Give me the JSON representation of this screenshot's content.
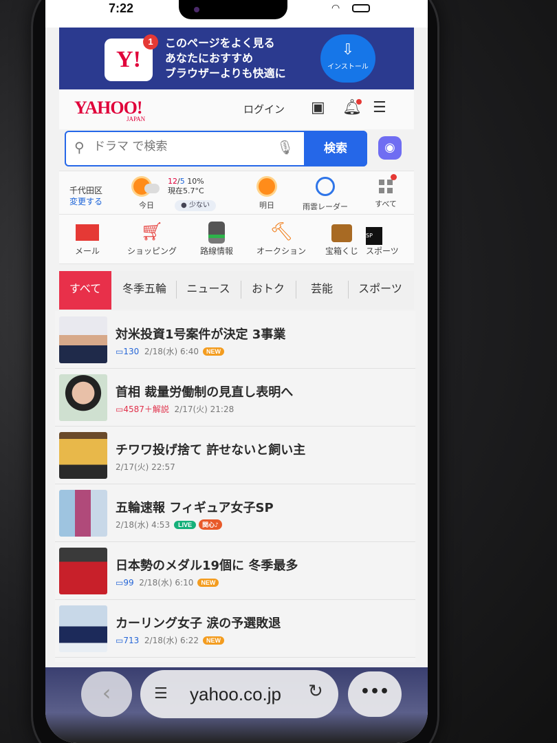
{
  "status": {
    "time": "7:22"
  },
  "banner": {
    "badge_count": "1",
    "logo_text": "Y!",
    "line1": "このページをよく見る",
    "line2": "あなたにおすすめ",
    "line3": "ブラウザーよりも快適に",
    "install_label": "インストール"
  },
  "header": {
    "logo": "YAHOO!",
    "logo_sub": "JAPAN",
    "login": "ログイン"
  },
  "search": {
    "placeholder": "ドラマ で検索",
    "button": "検索"
  },
  "weather": {
    "location": "千代田区",
    "change": "変更する",
    "today_label": "今日",
    "temp_hi": "12",
    "temp_lo": "5",
    "precip": "10%",
    "current": "現在5.7°C",
    "pollen": "少ない",
    "tomorrow_label": "明日",
    "radar_label": "雨雲レーダー",
    "all_label": "すべて"
  },
  "services": [
    {
      "label": "メール"
    },
    {
      "label": "ショッピング"
    },
    {
      "label": "路線情報"
    },
    {
      "label": "オークション"
    },
    {
      "label": "宝箱くじ"
    },
    {
      "label": "スポーツ"
    }
  ],
  "tabs": [
    "すべて",
    "冬季五輪",
    "ニュース",
    "おトク",
    "芸能",
    "スポーツ"
  ],
  "news": [
    {
      "title": "対米投資1号案件が決定 3事業",
      "comments": "130",
      "date": "2/18(水) 6:40",
      "badge": "NEW"
    },
    {
      "title": "首相 裁量労働制の見直し表明へ",
      "comments": "4587＋解説",
      "date": "2/17(火) 21:28",
      "badge": ""
    },
    {
      "title": "チワワ投げ捨て 許せないと飼い主",
      "comments": "",
      "date": "2/17(火) 22:57",
      "badge": ""
    },
    {
      "title": "五輪速報 フィギュア女子SP",
      "comments": "",
      "date": "2/18(水) 4:53",
      "badge": "LIVE",
      "badge2": "関心♪"
    },
    {
      "title": "日本勢のメダル19個に 冬季最多",
      "comments": "99",
      "date": "2/18(水) 6:10",
      "badge": "NEW"
    },
    {
      "title": "カーリング女子 涙の予選敗退",
      "comments": "713",
      "date": "2/18(水) 6:22",
      "badge": "NEW"
    }
  ],
  "browser": {
    "url": "yahoo.co.jp",
    "back_icon": "‹",
    "more_icon": "•••"
  }
}
